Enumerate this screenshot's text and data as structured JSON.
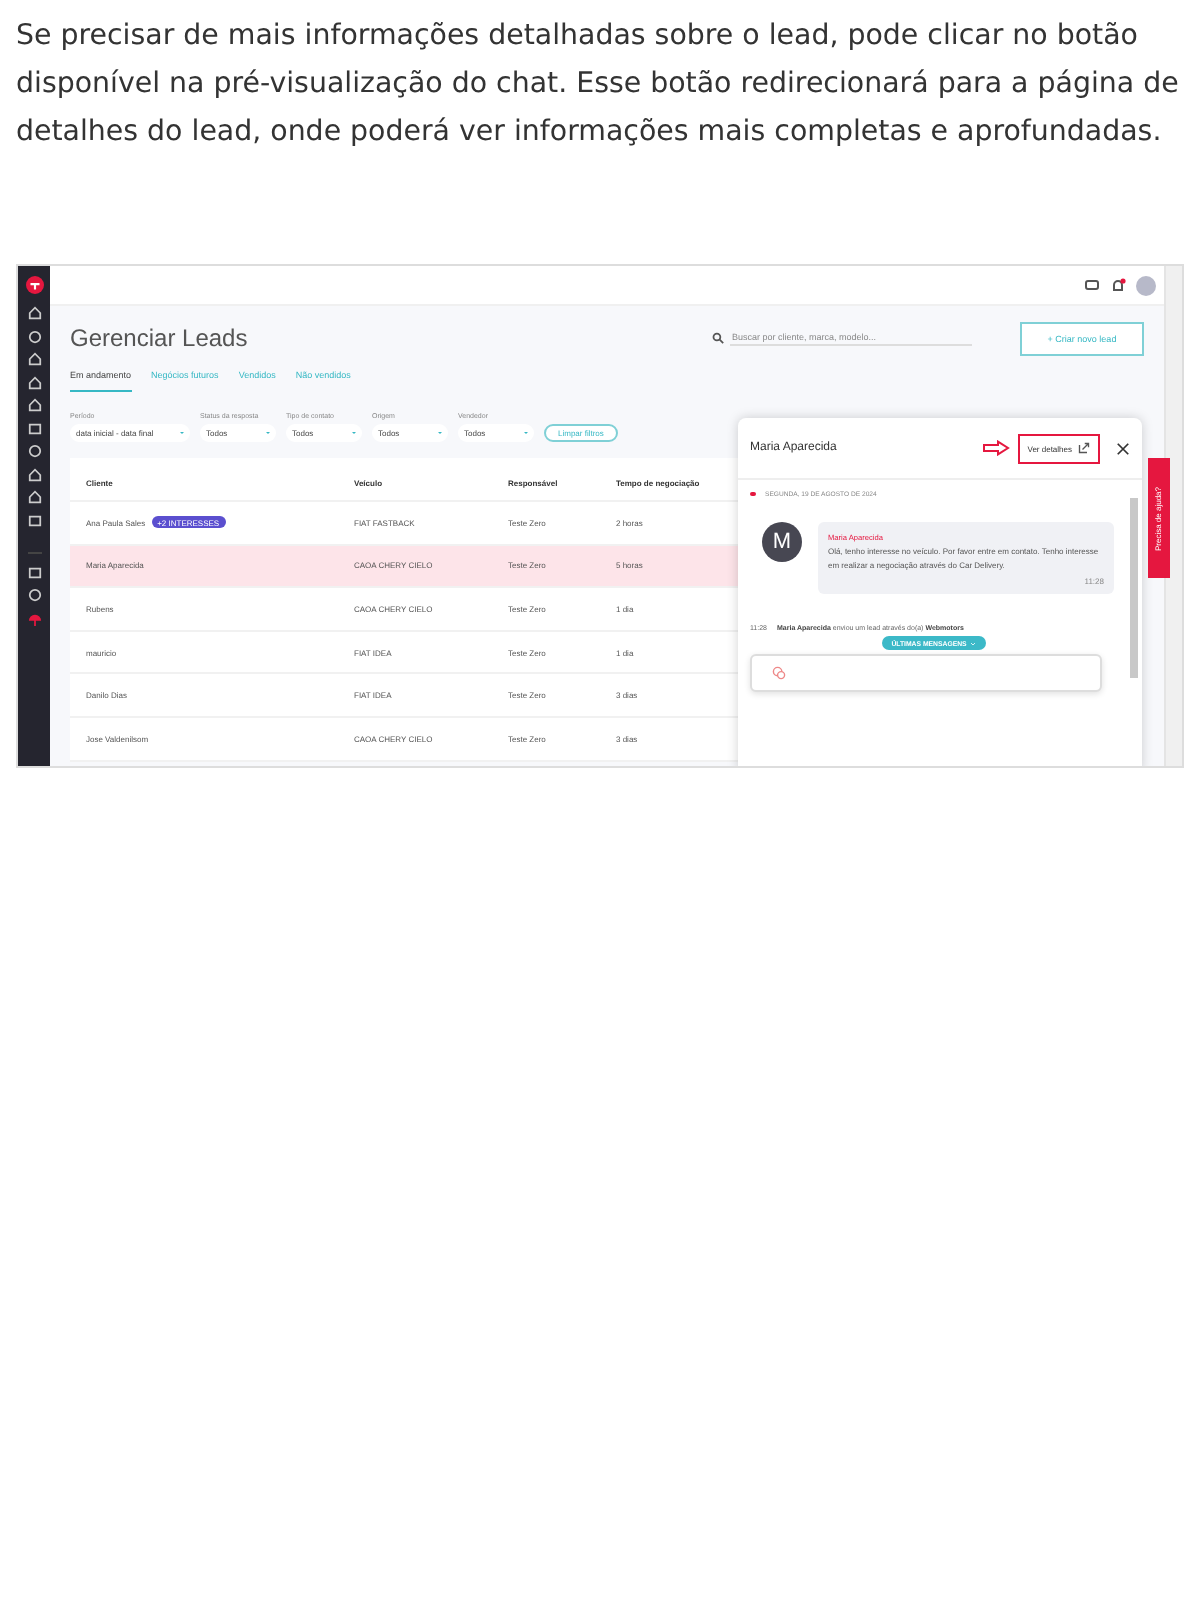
{
  "intro": "Se precisar de mais informações detalhadas sobre o lead, pode clicar no botão disponível na pré-visualização do chat. Esse botão redirecionará para a página de detalhes do lead, onde poderá ver informações mais completas e aprofundadas.",
  "screenshot": {
    "title": "Gerenciar Leads",
    "search": {
      "placeholder": "Buscar por cliente, marca, modelo..."
    },
    "create_button": "+ Criar novo lead",
    "tabs": [
      {
        "label": "Em andamento",
        "selected": true
      },
      {
        "label": "Negócios futuros",
        "selected": false
      },
      {
        "label": "Vendidos",
        "selected": false
      },
      {
        "label": "Não vendidos",
        "selected": false
      }
    ],
    "filters": [
      {
        "label": "Período",
        "value": "data inicial - data final"
      },
      {
        "label": "Status da resposta",
        "value": "Todos"
      },
      {
        "label": "Tipo de contato",
        "value": "Todos"
      },
      {
        "label": "Origem",
        "value": "Todos"
      },
      {
        "label": "Vendedor",
        "value": "Todos"
      }
    ],
    "clear_filters": "Limpar filtros",
    "table": {
      "columns": [
        "Cliente",
        "Veículo",
        "Responsável",
        "Tempo de negociação"
      ],
      "rows": [
        {
          "cells": [
            "Ana Paula Sales",
            "FIAT FASTBACK",
            "Teste Zero",
            "2 horas"
          ],
          "badge": "+2 INTERESSES",
          "selected": false
        },
        {
          "cells": [
            "Maria Aparecida",
            "CAOA CHERY CIELO",
            "Teste Zero",
            "5 horas"
          ],
          "selected": true
        },
        {
          "cells": [
            "Rubens",
            "CAOA CHERY CIELO",
            "Teste Zero",
            "1 dia"
          ],
          "selected": false
        },
        {
          "cells": [
            "mauricio",
            "FIAT IDEA",
            "Teste Zero",
            "1 dia"
          ],
          "selected": false
        },
        {
          "cells": [
            "Danilo Dias",
            "FIAT IDEA",
            "Teste Zero",
            "3 dias"
          ],
          "selected": false
        },
        {
          "cells": [
            "Jose Valdenilsom",
            "CAOA CHERY CIELO",
            "Teste Zero",
            "3 dias"
          ],
          "selected": false
        }
      ]
    },
    "chat": {
      "title": "Maria Aparecida",
      "details_button": "Ver detalhes",
      "date": "SEGUNDA, 19 DE AGOSTO DE 2024",
      "message": {
        "avatar": "M",
        "sender": "Maria Aparecida",
        "text": "Olá, tenho interesse no veículo. Por favor entre em contato. Tenho interesse em realizar a negociação através do Car Delivery.",
        "time": "11:28"
      },
      "event": {
        "time": "11:28",
        "sender": "Maria Aparecida",
        "text": "enviou um lead através do(a)",
        "source": "Webmotors"
      },
      "new_messages": "ÚLTIMAS MENSAGENS"
    },
    "help_tab": "Precisa de ajuda?"
  }
}
